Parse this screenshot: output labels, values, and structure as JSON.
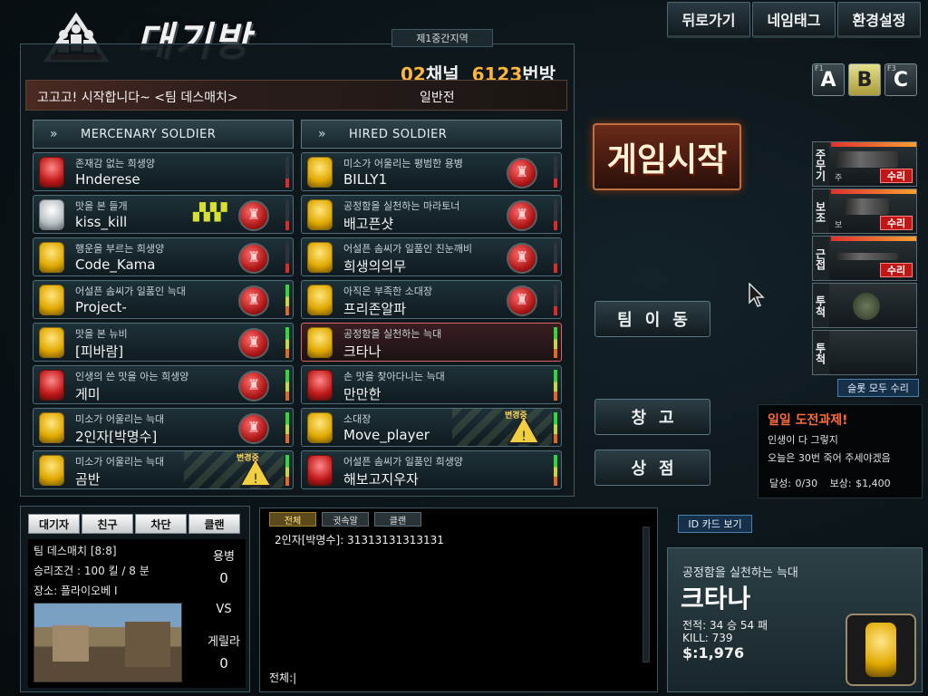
{
  "header": {
    "title": "대기방",
    "buttons": [
      "뒤로가기",
      "네임태그",
      "환경설정"
    ],
    "fkeys": [
      {
        "num": "F1",
        "label": "A"
      },
      {
        "num": "F2",
        "label": "B"
      },
      {
        "num": "F3",
        "label": "C"
      }
    ]
  },
  "room": {
    "region": "제1중간지역",
    "channel_num": "02",
    "channel_word": "채널",
    "room_num": "6123",
    "room_word": "번방",
    "title": "고고고! 시작합니다~ <팀 데스매치>",
    "mode": "일반전"
  },
  "teams": {
    "left_name": "MERCENARY SOLDIER",
    "right_name": "HIRED SOLDIER",
    "left": [
      {
        "rank": "존재감 없는 희생양",
        "name": "Hnderese"
      },
      {
        "rank": "맛을 본 들개",
        "name": "kiss_kill"
      },
      {
        "rank": "행운을 부르는 희생양",
        "name": "Code_Kama"
      },
      {
        "rank": "어설픈 솜씨가 일품인 늑대",
        "name": "Project-"
      },
      {
        "rank": "맛을 본 뉴비",
        "name": "[피바람]"
      },
      {
        "rank": "인생의 쓴 맛을 아는 희생양",
        "name": "게미"
      },
      {
        "rank": "미소가 어울리는 늑대",
        "name": "2인자[박명수]"
      },
      {
        "rank": "미소가 어울리는 늑대",
        "name": "곰반"
      }
    ],
    "right": [
      {
        "rank": "미소가 어울리는 평범한 용병",
        "name": "BILLY1"
      },
      {
        "rank": "공정함을 실천하는 마라토너",
        "name": "배고픈샷"
      },
      {
        "rank": "어설픈 솜씨가 일품인 진눈깨비",
        "name": "희생의의무"
      },
      {
        "rank": "아직은 부족한 소대장",
        "name": "프리존알파"
      },
      {
        "rank": "공정함을 실천하는 늑대",
        "name": "크타나"
      },
      {
        "rank": "손 맛을 찾아다니는 늑대",
        "name": "만만한"
      },
      {
        "rank": "소대장",
        "name": "Move_player"
      },
      {
        "rank": "어설픈 솜씨가 일품인 희생양",
        "name": "해보고지우자"
      }
    ],
    "changing_label": "변경중"
  },
  "actions": {
    "start": "게임시작",
    "team_move": "팀이동",
    "storage": "창고",
    "shop": "상점"
  },
  "weapons": {
    "slots": [
      {
        "label": "주무기",
        "sub": "주",
        "repair": "수리"
      },
      {
        "label": "보조",
        "sub": "보",
        "repair": "수리"
      },
      {
        "label": "근접",
        "sub": "",
        "repair": "수리"
      },
      {
        "label": "투척",
        "sub": "",
        "repair": ""
      },
      {
        "label": "투척",
        "sub": "",
        "repair": ""
      }
    ],
    "repair_all": "슬롯 모두 수리"
  },
  "challenge": {
    "title": "일일 도전과제!",
    "line1": "인생이 다 그렇지",
    "line2": "오늘은 30번 죽어 주세야겠음",
    "progress": "달성: 0/30",
    "reward": "보상: $1,400"
  },
  "lobby": {
    "tabs": [
      "대기자",
      "친구",
      "차단",
      "클랜"
    ],
    "mode_info": "팀 데스매치 [8:8]",
    "win_cond": "승리조건 : 100 킬 / 8 분",
    "map": "장소: 플라이오베 I",
    "team_a": "용병",
    "score_a": "0",
    "vs": "VS",
    "team_b": "게릴라",
    "score_b": "0"
  },
  "chat": {
    "tabs": [
      "전체",
      "귓속말",
      "클랜"
    ],
    "message": "2인자[박명수]: 31313131313131",
    "input_prefix": "전체:"
  },
  "id_card": {
    "button": "ID 카드 보기",
    "rank": "공정함을 실천하는 늑대",
    "name": "크타나",
    "record": "전적:  34 승 54 패",
    "kill": "KILL:  739",
    "money": "$:1,976"
  }
}
